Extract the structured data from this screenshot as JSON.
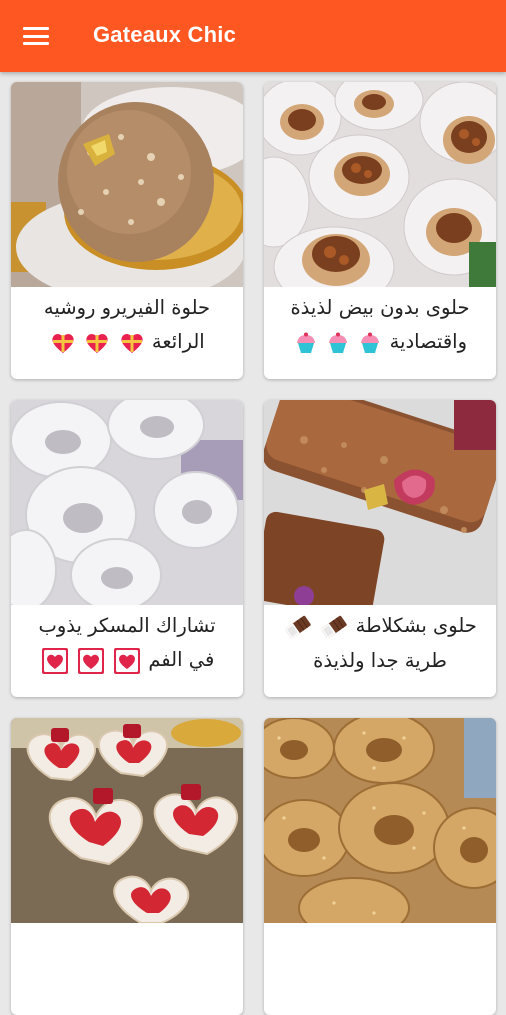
{
  "app": {
    "title": "Gateaux Chic",
    "menu_icon": "hamburger-menu-icon",
    "accent_color": "#ff5722"
  },
  "recipes": [
    {
      "line1": "حلوى بدون بيض لذيذة",
      "line2": "واقتصادية",
      "emoji": "cupcake-icon",
      "emoji_count": 3
    },
    {
      "line1": "حلوة الفيريرو روشيه",
      "line2": "الرائعة",
      "emoji": "gift-heart-icon",
      "emoji_count": 3
    },
    {
      "line1": "حلوى بشكلاطة",
      "line2": "طرية جدا ولذيذة",
      "emoji": "chocolate-bar-icon",
      "emoji_count": 2
    },
    {
      "line1": "تشاراك المسكر يذوب",
      "line2": "في الفم",
      "emoji": "heart-suit-icon",
      "emoji_count": 3
    },
    {
      "line1": "",
      "line2": "",
      "emoji": "",
      "emoji_count": 0
    },
    {
      "line1": "",
      "line2": "",
      "emoji": "",
      "emoji_count": 0
    }
  ]
}
